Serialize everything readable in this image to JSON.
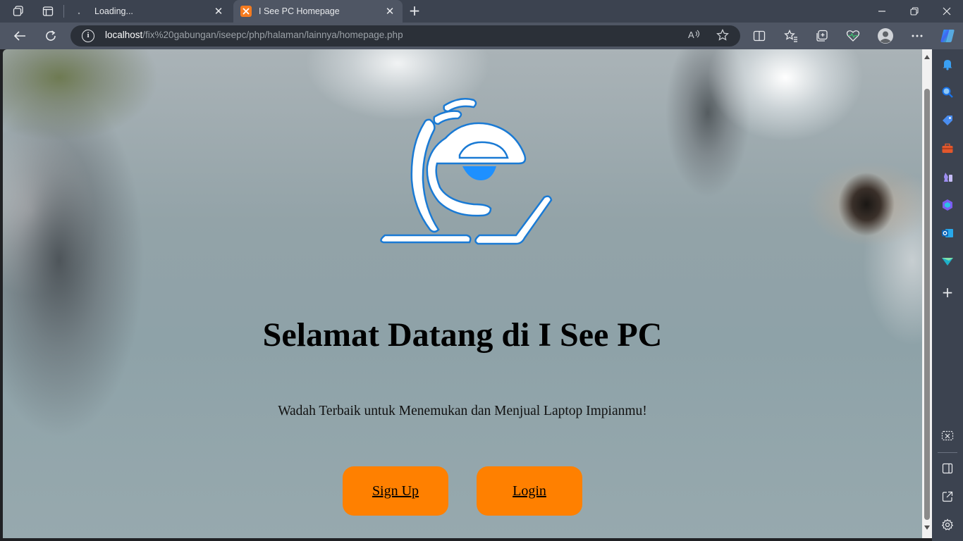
{
  "browser": {
    "tabs": [
      {
        "title": "Loading...",
        "active": false
      },
      {
        "title": "I See PC Homepage",
        "active": true
      }
    ],
    "url": {
      "host": "localhost",
      "path": "/fix%20gabungan/iseepc/php/halaman/lainnya/homepage.php"
    },
    "icons": {
      "workspaces": "workspaces-icon",
      "tab_actions": "tab-actions-icon",
      "back": "back-arrow-icon",
      "refresh": "refresh-icon",
      "site_info": "info-icon",
      "read_aloud": "read-aloud-icon",
      "favorite": "star-icon",
      "split_screen": "split-screen-icon",
      "favorites": "favorites-icon",
      "collections": "collections-icon",
      "browser_essentials": "heart-pulse-icon",
      "profile": "profile-icon",
      "more": "more-icon",
      "copilot": "copilot-icon"
    }
  },
  "sidebar": {
    "icons": [
      "bell-icon",
      "search-icon",
      "shopping-tag-icon",
      "toolbox-icon",
      "chess-icon",
      "m365-icon",
      "outlook-icon",
      "drop-icon",
      "add-icon",
      "screenshot-icon",
      "sidebar-toggle-icon",
      "external-link-icon",
      "settings-icon"
    ]
  },
  "page": {
    "headline": "Selamat Datang di I See PC",
    "tagline": "Wadah Terbaik untuk Menemukan dan Menjual Laptop Impianmu!",
    "buttons": {
      "signup": "Sign Up",
      "login": "Login"
    },
    "colors": {
      "button": "#ff8000",
      "logo_outline": "#1a7ad4",
      "logo_dot": "#1e90ff"
    }
  }
}
